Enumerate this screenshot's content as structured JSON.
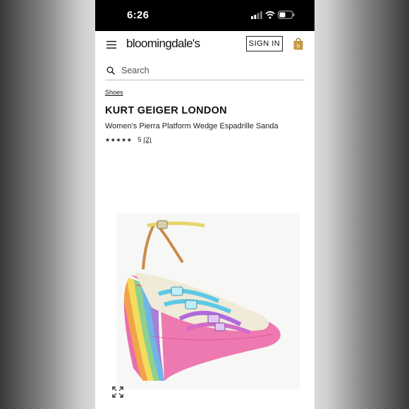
{
  "status_bar": {
    "time": "6:26"
  },
  "header": {
    "logo": "bloomingdale's",
    "sign_in": "SIGN IN"
  },
  "search": {
    "placeholder": "Search"
  },
  "breadcrumb": "Shoes",
  "product": {
    "brand": "KURT GEIGER LONDON",
    "name": "Women's Pierra Platform Wedge Espadrille Sanda",
    "stars": "★★★★★",
    "rating": "5",
    "review_count": "(2)"
  },
  "icons": [
    "signal-icon",
    "wifi-icon",
    "battery-icon",
    "menu-icon",
    "shopping-bag-icon",
    "search-icon",
    "expand-icon"
  ]
}
